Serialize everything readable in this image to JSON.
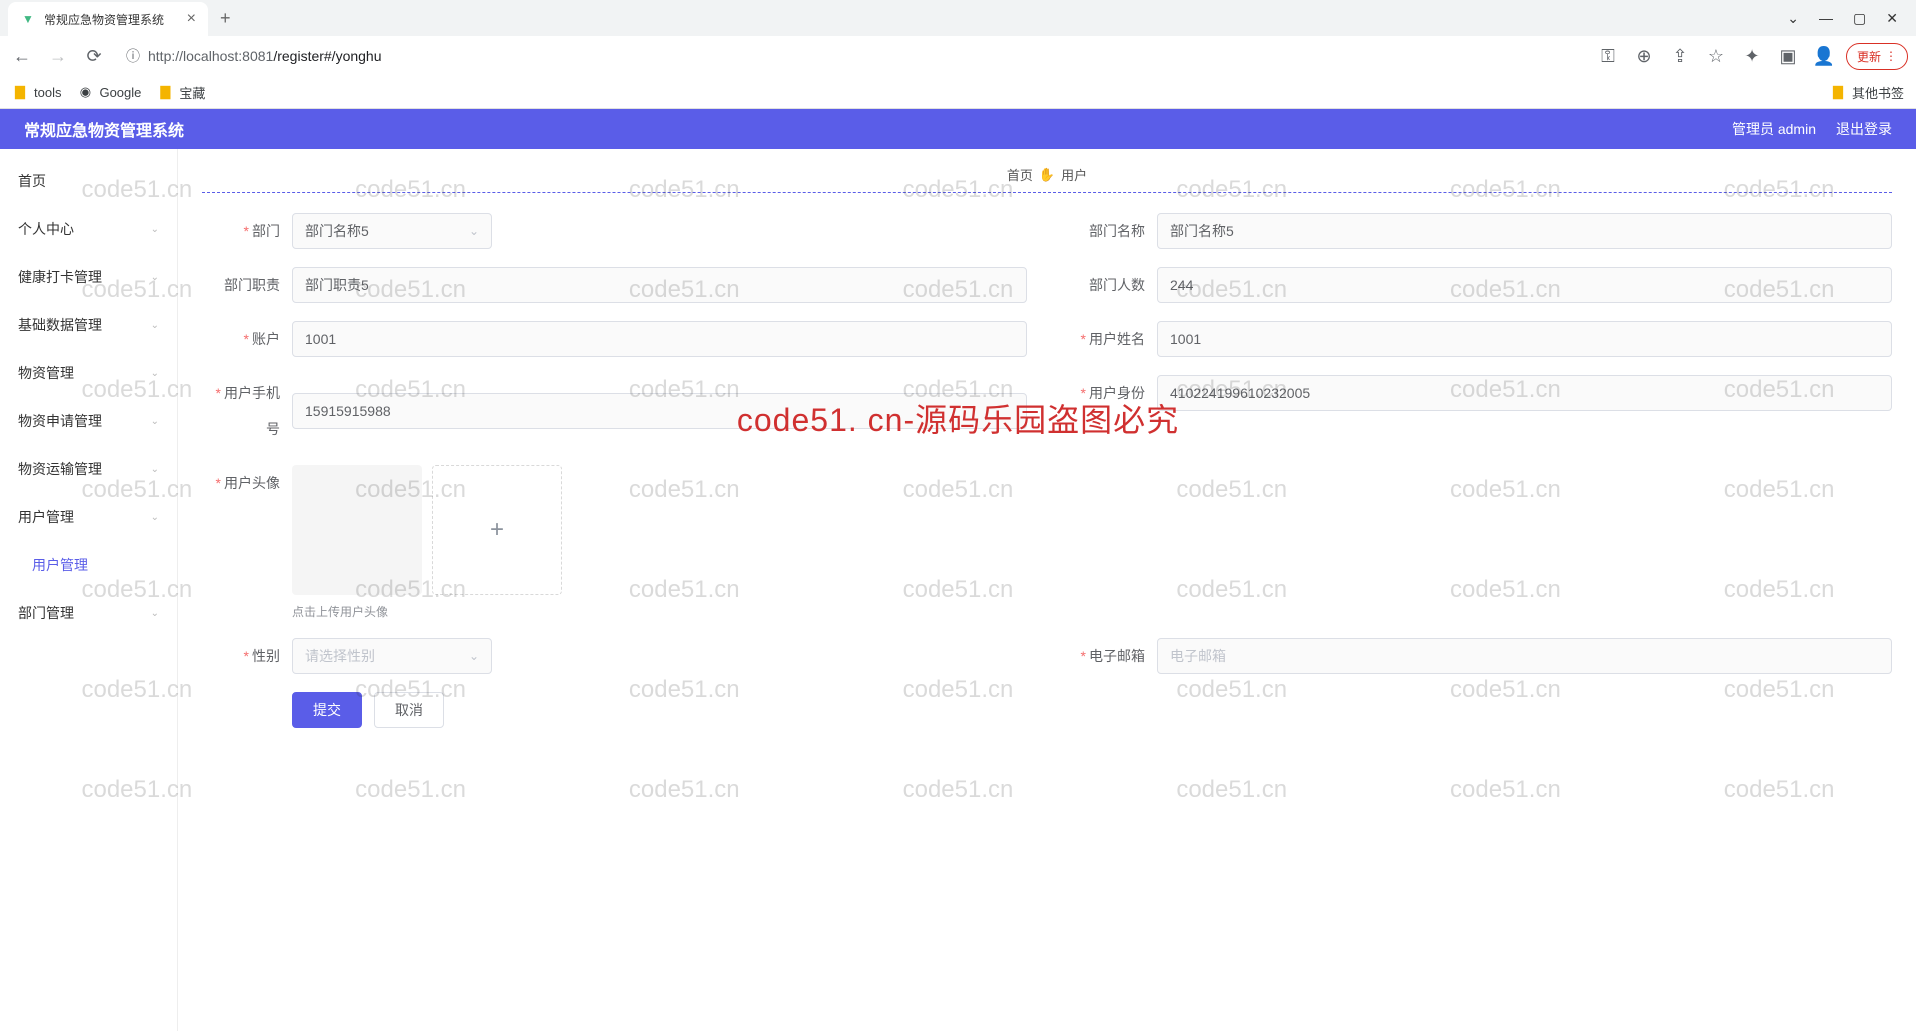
{
  "browser": {
    "tab_title": "常规应急物资管理系统",
    "url_host": "localhost:8081",
    "url_path": "/register#/yonghu",
    "update_label": "更新",
    "bookmarks": [
      "tools",
      "Google",
      "宝藏"
    ],
    "other_bookmarks": "其他书签"
  },
  "header": {
    "title": "常规应急物资管理系统",
    "user_label": "管理员 admin",
    "logout": "退出登录"
  },
  "sidebar": {
    "items": [
      {
        "label": "首页",
        "expandable": false
      },
      {
        "label": "个人中心",
        "expandable": true
      },
      {
        "label": "健康打卡管理",
        "expandable": true
      },
      {
        "label": "基础数据管理",
        "expandable": true
      },
      {
        "label": "物资管理",
        "expandable": true
      },
      {
        "label": "物资申请管理",
        "expandable": true
      },
      {
        "label": "物资运输管理",
        "expandable": true
      },
      {
        "label": "用户管理",
        "expandable": true
      },
      {
        "label": "用户管理",
        "expandable": false,
        "active": true
      },
      {
        "label": "部门管理",
        "expandable": true
      }
    ]
  },
  "breadcrumb": {
    "home": "首页",
    "current": "用户"
  },
  "form": {
    "dept": {
      "label": "部门",
      "value": "部门名称5"
    },
    "dept_name": {
      "label": "部门名称",
      "value": "部门名称5"
    },
    "dept_duty": {
      "label": "部门职责",
      "value": "部门职责5"
    },
    "dept_count": {
      "label": "部门人数",
      "value": "244"
    },
    "account": {
      "label": "账户",
      "value": "1001"
    },
    "user_name": {
      "label": "用户姓名",
      "value": "1001"
    },
    "phone": {
      "label": "用户手机号",
      "value": "15915915988"
    },
    "id_card": {
      "label": "用户身份",
      "value": "410224199610232005"
    },
    "avatar": {
      "label": "用户头像",
      "hint": "点击上传用户头像"
    },
    "gender": {
      "label": "性别",
      "placeholder": "请选择性别"
    },
    "email": {
      "label": "电子邮箱",
      "placeholder": "电子邮箱"
    },
    "submit": "提交",
    "cancel": "取消"
  },
  "watermark": {
    "small": "code51.cn",
    "big": "code51. cn-源码乐园盗图必究"
  }
}
